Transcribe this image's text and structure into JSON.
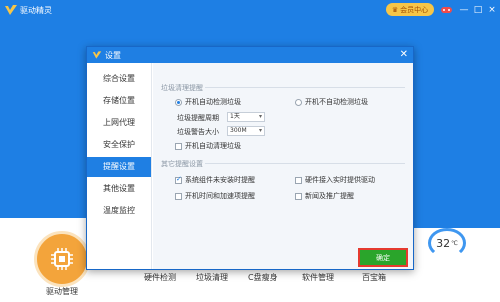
{
  "app": {
    "name": "驱动精灵",
    "vip_label": "会员中心",
    "window_controls": [
      "—",
      "□",
      "×"
    ]
  },
  "bottom": {
    "manager_label": "驱动管理",
    "tabs": [
      "硬件检测",
      "垃圾清理",
      "C盘瘦身",
      "软件管理",
      "百宝箱"
    ],
    "temperature": "32",
    "temperature_unit": "℃"
  },
  "dialog": {
    "title": "设置",
    "sidebar": [
      "综合设置",
      "存储位置",
      "上网代理",
      "安全保护",
      "提醒设置",
      "其他设置",
      "温度监控"
    ],
    "active_index": 4,
    "section1": {
      "title": "垃圾清理提醒",
      "radio_auto": "开机自动检测垃圾",
      "radio_manual": "开机不自动检测垃圾",
      "cycle_label": "垃圾提醒周期",
      "cycle_value": "1天",
      "size_label": "垃圾警告大小",
      "size_value": "300M",
      "auto_clean": "开机自动清理垃圾"
    },
    "section2": {
      "title": "其它提醒设置",
      "opt1": "系统组件未安装时提醒",
      "opt2": "硬件接入实时提供驱动",
      "opt3": "开机时间和加速项提醒",
      "opt4": "新闻及推广提醒"
    },
    "ok_label": "确定"
  }
}
